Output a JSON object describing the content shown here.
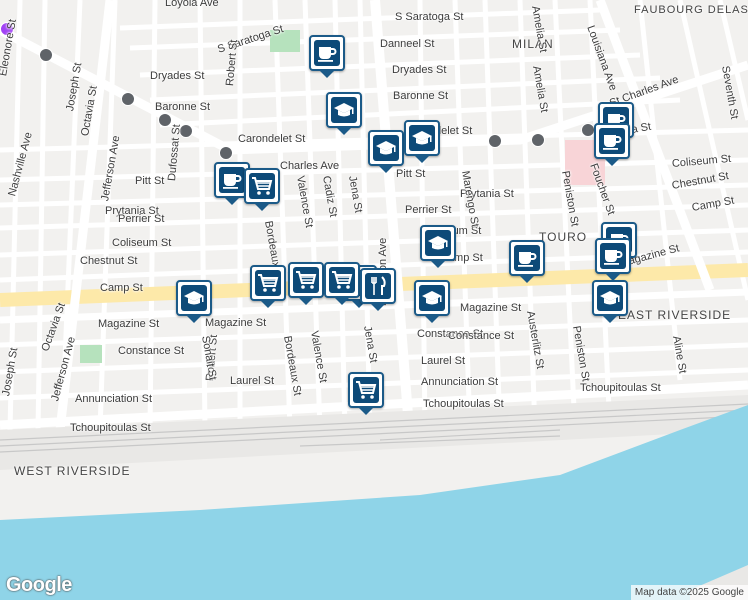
{
  "map": {
    "areas": [
      {
        "id": "milan",
        "label": "MILAN"
      },
      {
        "id": "touro",
        "label": "TOURO"
      },
      {
        "id": "east-riverside",
        "label": "EAST RIVERSIDE"
      },
      {
        "id": "west-riverside",
        "label": "WEST RIVERSIDE"
      },
      {
        "id": "faubourg",
        "label": "FAUBOURG DELASSIZE"
      }
    ],
    "streets": [
      "Loyola Ave",
      "S Saratoga St",
      "S Saratoga St",
      "Danneel St",
      "Dryades St",
      "Dryades St",
      "Baronne St",
      "Baronne St",
      "Carondelet St",
      "Carondelet St",
      "Charles Ave",
      "St Charles Ave",
      "Pitt St",
      "Pitt St",
      "Prytania St",
      "Prytania St",
      "Prytania St",
      "Perrier St",
      "Perrier St",
      "Coliseum St",
      "Coliseum St",
      "Coliseum St",
      "Chestnut St",
      "Chestnut St",
      "Camp St",
      "Camp St",
      "Magazine St",
      "Magazine St",
      "Magazine St",
      "Constance St",
      "Constance St",
      "Laurel St",
      "Laurel St",
      "Annunciation St",
      "Annunciation St",
      "Tchoupitoulas St",
      "Tchoupitoulas St",
      "Tchoupitoulas St",
      "Nashville Ave",
      "Joseph St",
      "Joseph St",
      "Octavia St",
      "Octavia St",
      "Jefferson Ave",
      "Jefferson Ave",
      "Dufossat St",
      "Robert St",
      "Robert St",
      "Bordeaux St",
      "Valence St",
      "Valence St",
      "Cadiz St",
      "Jena St",
      "Jena St",
      "Napoleon Ave",
      "Marengo St",
      "Amelia St",
      "Peniston St",
      "Peniston St",
      "Austerlitz St",
      "Louisiana Ave",
      "Foucher St",
      "Aline St",
      "Seventh St",
      "Sonait St",
      "Eleonore St",
      "Bordeaux St",
      "Amelia St",
      "Constance St",
      "Magazine St",
      "Camp St"
    ],
    "markers": [
      {
        "type": "cafe"
      },
      {
        "type": "school"
      },
      {
        "type": "school"
      },
      {
        "type": "school"
      },
      {
        "type": "cafe"
      },
      {
        "type": "grocery"
      },
      {
        "type": "cafe"
      },
      {
        "type": "school"
      },
      {
        "type": "grocery"
      },
      {
        "type": "grocery"
      },
      {
        "type": "restaurant"
      },
      {
        "type": "school"
      },
      {
        "type": "grocery"
      },
      {
        "type": "cafe"
      },
      {
        "type": "cafe"
      },
      {
        "type": "cafe"
      },
      {
        "type": "school"
      },
      {
        "type": "cafe"
      },
      {
        "type": "grocery"
      },
      {
        "type": "school"
      },
      {
        "type": "restaurant"
      }
    ],
    "logo": "Google",
    "attribution": "Map data ©2025 Google",
    "colors": {
      "water": "#8fd4e8",
      "marker_border": "#1b5a88",
      "marker_fill": "#0d4a78",
      "park": "#b6e2bd",
      "major_road": "#ffffff",
      "rail": "#c8c8c8"
    }
  }
}
